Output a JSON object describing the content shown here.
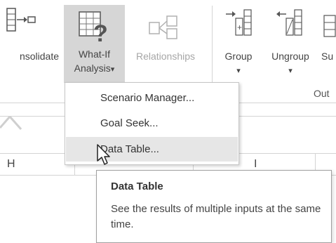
{
  "ribbon": {
    "consolidate_label": "nsolidate",
    "whatif_label_line1": "What-If",
    "whatif_label_line2": "Analysis",
    "whatif_arrow": "▾",
    "relationships_label": "Relationships",
    "group_label": "Group",
    "ungroup_label": "Ungroup",
    "subtotal_label": "Su",
    "group_arrow": "▾",
    "ungroup_arrow": "▾",
    "outline_section_label": "Out"
  },
  "columns": [
    "H",
    "I"
  ],
  "menu": {
    "items": [
      {
        "label": "Scenario Manager..."
      },
      {
        "label": "Goal Seek..."
      },
      {
        "label": "Data Table..."
      }
    ]
  },
  "tooltip": {
    "title": "Data Table",
    "description": "See the results of multiple inputs at the same time."
  },
  "colors": {
    "highlight": "#d6d6d6",
    "menu_hover": "#e6e6e6"
  }
}
